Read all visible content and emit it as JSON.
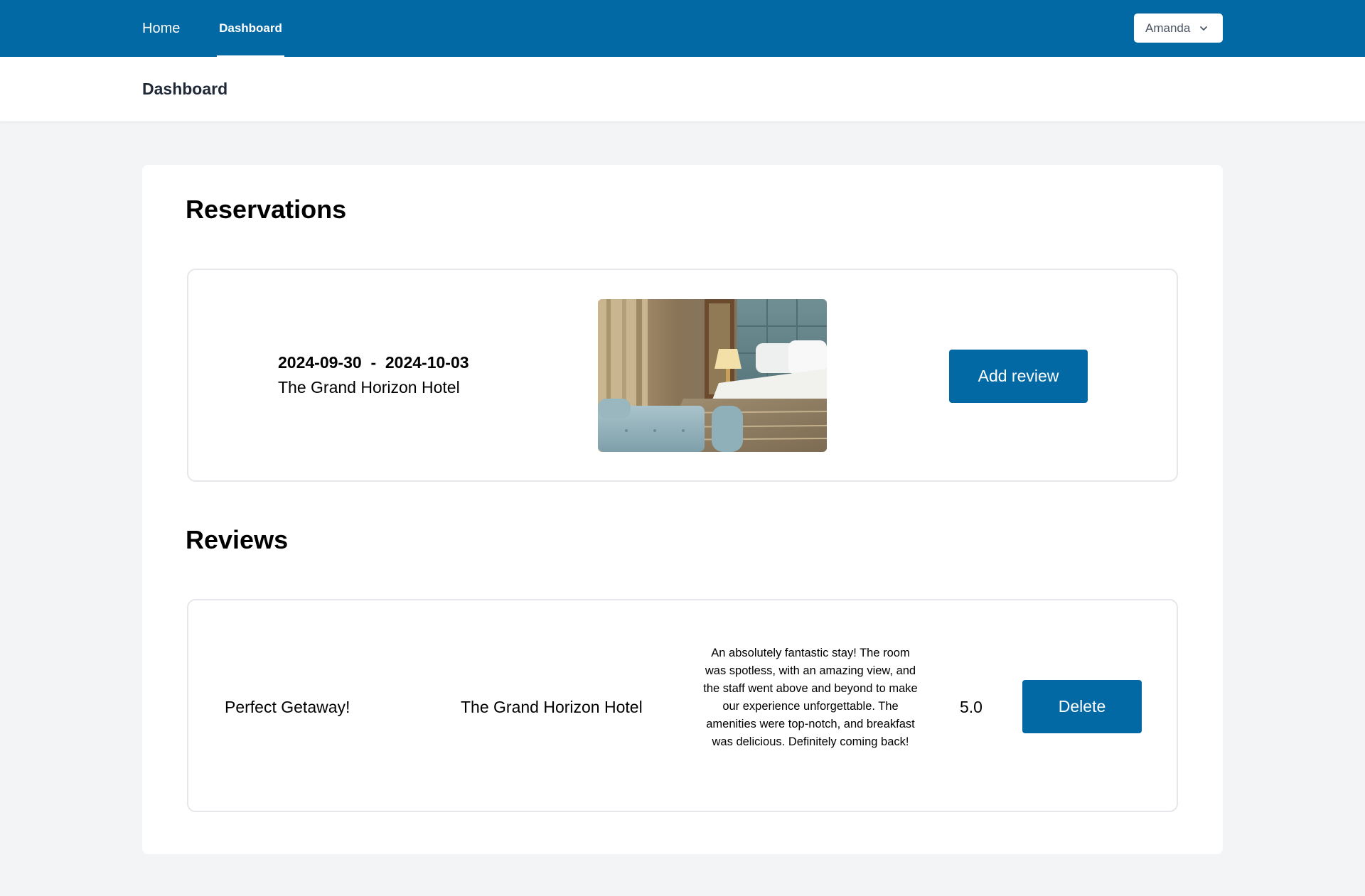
{
  "nav": {
    "home_label": "Home",
    "dashboard_label": "Dashboard",
    "user_name": "Amanda",
    "brand_color": "#0369a5"
  },
  "page": {
    "title": "Dashboard"
  },
  "reservations": {
    "heading": "Reservations",
    "items": [
      {
        "date_start": "2024-09-30",
        "date_separator": "-",
        "date_end": "2024-10-03",
        "hotel": "The Grand Horizon Hotel",
        "image_alt": "hotel room photo",
        "action_label": "Add review"
      }
    ]
  },
  "reviews": {
    "heading": "Reviews",
    "items": [
      {
        "title": "Perfect Getaway!",
        "hotel": "The Grand Horizon Hotel",
        "text": "An absolutely fantastic stay! The room was spotless, with an amazing view, and the staff went above and beyond to make our experience unforgettable. The amenities were top-notch, and breakfast was delicious. Definitely coming back!",
        "rating": "5.0",
        "action_label": "Delete"
      }
    ]
  }
}
